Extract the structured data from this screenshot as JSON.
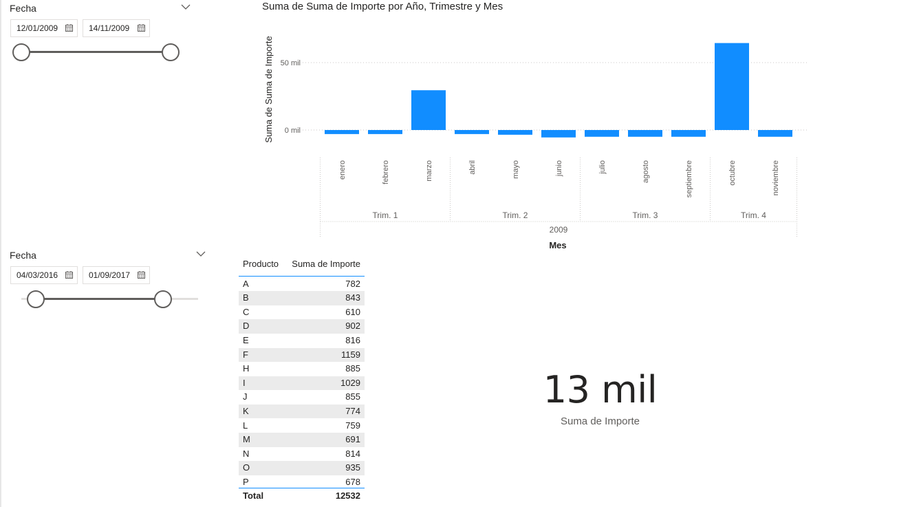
{
  "slicer_top": {
    "title": "Fecha",
    "start_date": "12/01/2009",
    "end_date": "14/11/2009"
  },
  "slicer_bottom": {
    "title": "Fecha",
    "start_date": "04/03/2016",
    "end_date": "01/09/2017"
  },
  "chart": {
    "title": "Suma de Suma de Importe por Año, Trimestre y Mes",
    "ylabel": "Suma de Suma de Importe",
    "xlabel": "Mes",
    "bar_color": "#118dff"
  },
  "chart_data": {
    "type": "bar",
    "title": "Suma de Suma de Importe por Año, Trimestre y Mes",
    "xlabel": "Mes",
    "ylabel": "Suma de Suma de Importe",
    "categories": [
      "enero",
      "febrero",
      "marzo",
      "abril",
      "mayo",
      "junio",
      "julio",
      "agosto",
      "septiembre",
      "octubre",
      "noviembre"
    ],
    "values": [
      -3000,
      -3000,
      29500,
      -3000,
      -3500,
      -5500,
      -5000,
      -5000,
      -5000,
      64500,
      -5000
    ],
    "y_ticks": [
      "0 mil",
      "50 mil"
    ],
    "ylim": [
      -10000,
      70000
    ],
    "quarters": [
      {
        "label": "Trim. 1",
        "months": 3
      },
      {
        "label": "Trim. 2",
        "months": 3
      },
      {
        "label": "Trim. 3",
        "months": 3
      },
      {
        "label": "Trim. 4",
        "months": 2
      }
    ],
    "year": "2009",
    "grid": true,
    "color": "#118dff"
  },
  "table": {
    "columns": [
      "Producto",
      "Suma de Importe"
    ],
    "rows": [
      {
        "producto": "A",
        "importe": "782"
      },
      {
        "producto": "B",
        "importe": "843"
      },
      {
        "producto": "C",
        "importe": "610"
      },
      {
        "producto": "D",
        "importe": "902"
      },
      {
        "producto": "E",
        "importe": "816"
      },
      {
        "producto": "F",
        "importe": "1159"
      },
      {
        "producto": "H",
        "importe": "885"
      },
      {
        "producto": "I",
        "importe": "1029"
      },
      {
        "producto": "J",
        "importe": "855"
      },
      {
        "producto": "K",
        "importe": "774"
      },
      {
        "producto": "L",
        "importe": "759"
      },
      {
        "producto": "M",
        "importe": "691"
      },
      {
        "producto": "N",
        "importe": "814"
      },
      {
        "producto": "O",
        "importe": "935"
      },
      {
        "producto": "P",
        "importe": "678"
      }
    ],
    "total_label": "Total",
    "total_value": "12532"
  },
  "card": {
    "value": "13 mil",
    "label": "Suma de Importe"
  }
}
